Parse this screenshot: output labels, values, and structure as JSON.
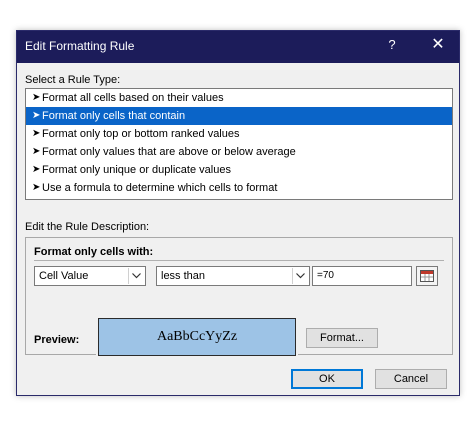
{
  "dialog": {
    "title": "Edit Formatting Rule",
    "help_glyph": "?",
    "close_glyph": "✕"
  },
  "rule_type": {
    "label": "Select a Rule Type:",
    "arrow_glyph": "➤",
    "items": [
      {
        "label": "Format all cells based on their values",
        "selected": false
      },
      {
        "label": "Format only cells that contain",
        "selected": true
      },
      {
        "label": "Format only top or bottom ranked values",
        "selected": false
      },
      {
        "label": "Format only values that are above or below average",
        "selected": false
      },
      {
        "label": "Format only unique or duplicate values",
        "selected": false
      },
      {
        "label": "Use a formula to determine which cells to format",
        "selected": false
      }
    ]
  },
  "description": {
    "label": "Edit the Rule Description:",
    "heading": "Format only cells with:",
    "condition_type": "Cell Value",
    "operator": "less than",
    "value": "=70",
    "preview_label": "Preview:",
    "preview_sample": "AaBbCcYyZz",
    "preview_fill": "#9dc3e6",
    "format_button": "Format..."
  },
  "footer": {
    "ok": "OK",
    "cancel": "Cancel"
  },
  "colors": {
    "titlebar": "#1c1c5a",
    "selection": "#0a64c8",
    "accent": "#0078d7"
  }
}
